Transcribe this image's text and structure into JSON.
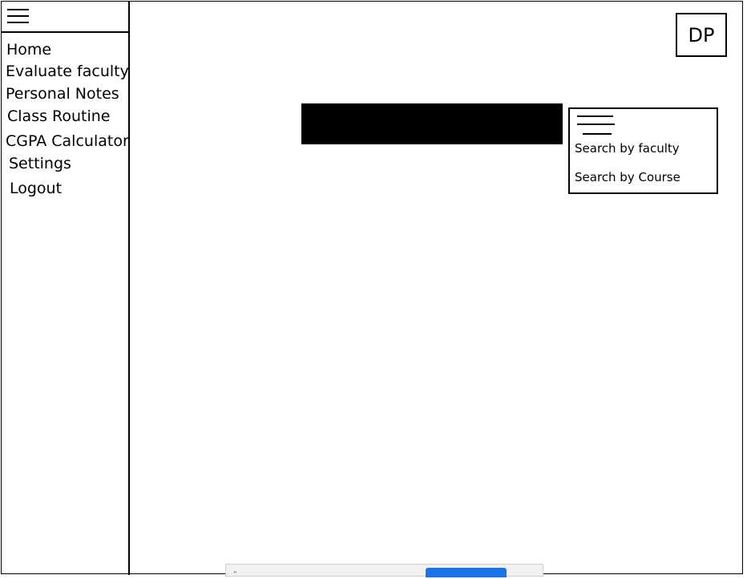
{
  "header": {
    "avatar_text": "DP"
  },
  "sidebar": {
    "items": [
      {
        "label": "Home"
      },
      {
        "label": "Evaluate faculty"
      },
      {
        "label": "Personal Notes"
      },
      {
        "label": "Class Routine"
      },
      {
        "label": "CGPA Calculator"
      },
      {
        "label": "Settings"
      },
      {
        "label": "Logout"
      }
    ]
  },
  "search": {
    "options": [
      {
        "label": "Search by faculty"
      },
      {
        "label": "Search by Course"
      }
    ]
  },
  "bottom_bar": {
    "indicator": "”"
  },
  "colors": {
    "bottom_button": "#1a73e8",
    "search_bar": "#000000"
  }
}
